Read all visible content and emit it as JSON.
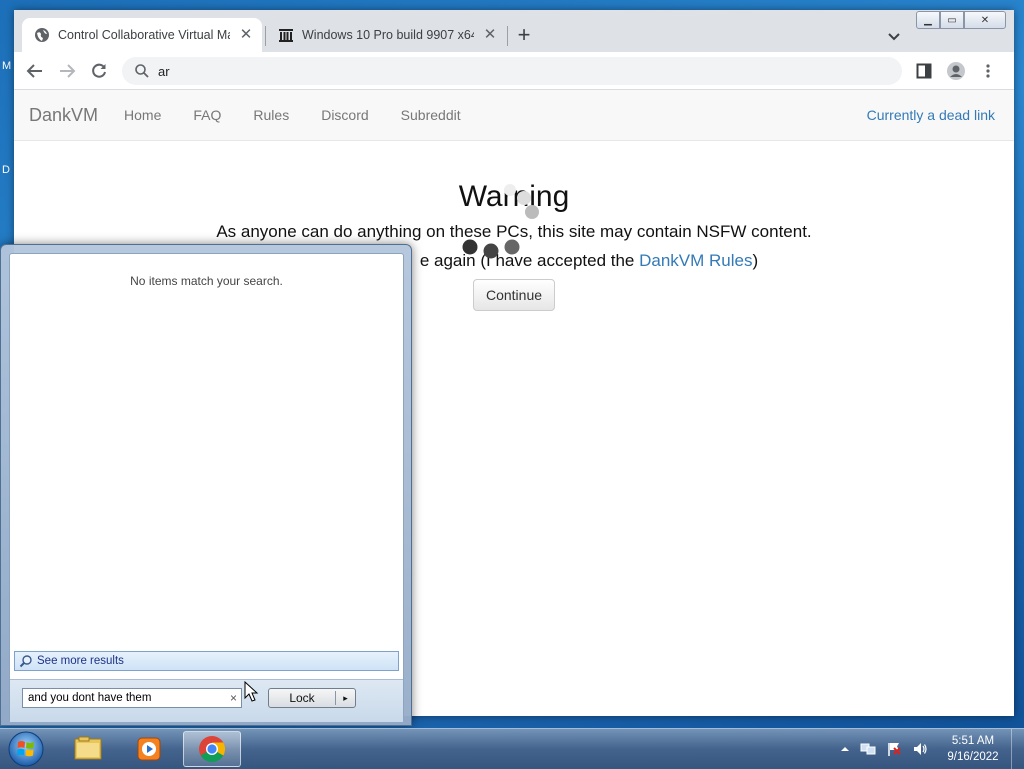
{
  "desktop": {
    "glyph_top": "M",
    "glyph_mid": "D"
  },
  "browser": {
    "tabs": [
      {
        "title": "Control Collaborative Virtual Ma",
        "icon": "globe-icon",
        "active": true
      },
      {
        "title": "Windows 10 Pro build 9907 x64 |",
        "icon": "archive-icon",
        "active": false
      }
    ],
    "omnibox": {
      "text": "ar",
      "icon": "search-icon"
    }
  },
  "site": {
    "brand": "DankVM",
    "nav": [
      "Home",
      "FAQ",
      "Rules",
      "Discord",
      "Subreddit"
    ],
    "nav_right": "Currently a dead link",
    "warning_title": "Warning",
    "line1": "As anyone can do anything on these PCs, this site may contain NSFW content.",
    "line2_prefix": "e again (I have accepted the ",
    "line2_link": "DankVM Rules",
    "line2_suffix": ")",
    "continue_label": "Continue"
  },
  "start_menu": {
    "no_items": "No items match your search.",
    "see_more": "See more results",
    "search_value": "and you dont have them",
    "clear_icon": "×",
    "lock_label": "Lock",
    "lock_arrow": "▸"
  },
  "taskbar": {
    "items": [
      "start-orb",
      "file-explorer-icon",
      "media-player-icon",
      "chrome-icon"
    ],
    "clock_time": "5:51 AM",
    "clock_date": "9/16/2022"
  },
  "colors": {
    "link": "#337ab7",
    "desktop": "#1c6fb8"
  }
}
